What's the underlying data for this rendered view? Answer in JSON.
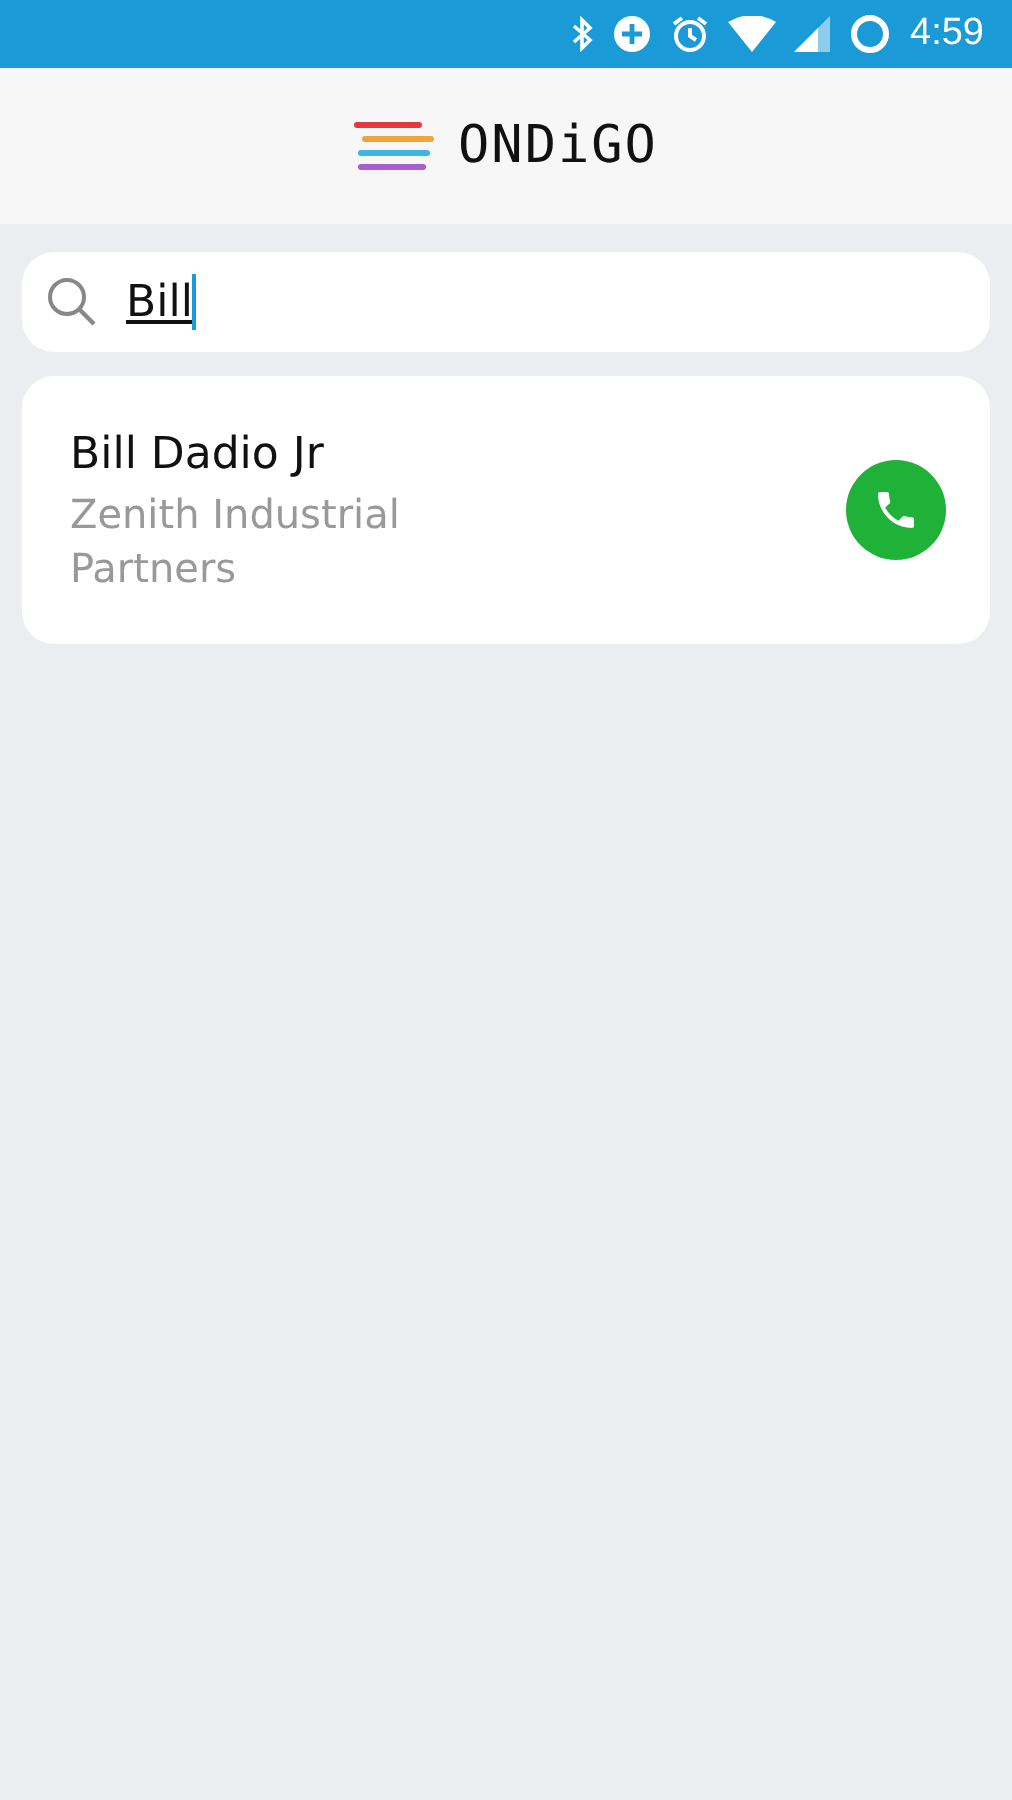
{
  "status_bar": {
    "time": "4:59"
  },
  "header": {
    "logo": "ONDiGO"
  },
  "search": {
    "value": "Bill"
  },
  "contacts": [
    {
      "name": "Bill Dadio Jr",
      "company": "Zenith Industrial Partners"
    }
  ]
}
